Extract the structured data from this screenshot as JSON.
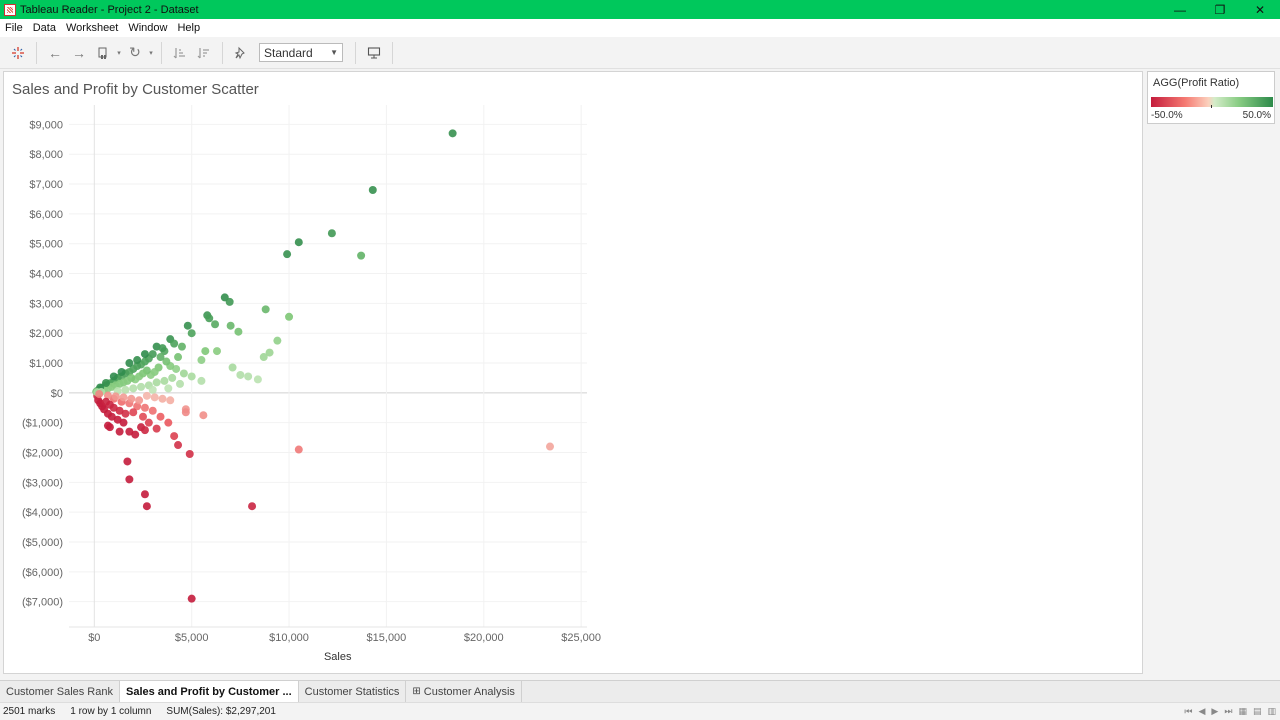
{
  "window": {
    "title": "Tableau Reader - Project 2 - Dataset",
    "minimize": "—",
    "maximize": "❐",
    "close": "✕"
  },
  "menu": [
    "File",
    "Data",
    "Worksheet",
    "Window",
    "Help"
  ],
  "toolbar": {
    "view_select": "Standard"
  },
  "sheet": {
    "title": "Sales and Profit by Customer Scatter"
  },
  "legend": {
    "title": "AGG(Profit Ratio)",
    "min_label": "-50.0%",
    "max_label": "50.0%"
  },
  "tabs": [
    "Customer Sales Rank",
    "Sales and Profit by Customer ...",
    "Customer Statistics",
    "Customer Analysis"
  ],
  "tabs_active": 1,
  "status": {
    "marks": "2501 marks",
    "layout": "1 row by 1 column",
    "sum": "SUM(Sales): $2,297,201"
  },
  "colors": {
    "titlebar": "#00c85c",
    "neg": "#c41c3c",
    "pos": "#2d8a4a"
  },
  "chart_data": {
    "type": "scatter",
    "title": "Sales and Profit by Customer Scatter",
    "xlabel": "Sales",
    "ylabel": "",
    "xlim": [
      -1300,
      25300
    ],
    "ylim": [
      -7850,
      9650
    ],
    "x_ticks": [
      0,
      5000,
      10000,
      15000,
      20000,
      25000
    ],
    "x_tick_labels": [
      "$0",
      "$5,000",
      "$10,000",
      "$15,000",
      "$20,000",
      "$25,000"
    ],
    "y_ticks": [
      9000,
      8000,
      7000,
      6000,
      5000,
      4000,
      3000,
      2000,
      1000,
      0,
      -1000,
      -2000,
      -3000,
      -4000,
      -5000,
      -6000,
      -7000
    ],
    "y_tick_labels": [
      "$9,000",
      "$8,000",
      "$7,000",
      "$6,000",
      "$5,000",
      "$4,000",
      "$3,000",
      "$2,000",
      "$1,000",
      "$0",
      "($1,000)",
      "($2,000)",
      "($3,000)",
      "($4,000)",
      "($5,000)",
      "($6,000)",
      "($7,000)"
    ],
    "color_by": "Profit Ratio",
    "color_range": [
      -0.5,
      0.5
    ],
    "points": [
      {
        "x": 18400,
        "y": 8700,
        "r": 0.47
      },
      {
        "x": 14300,
        "y": 6800,
        "r": 0.47
      },
      {
        "x": 12200,
        "y": 5350,
        "r": 0.44
      },
      {
        "x": 10500,
        "y": 5050,
        "r": 0.48
      },
      {
        "x": 9900,
        "y": 4650,
        "r": 0.47
      },
      {
        "x": 13700,
        "y": 4600,
        "r": 0.34
      },
      {
        "x": 6700,
        "y": 3200,
        "r": 0.48
      },
      {
        "x": 6950,
        "y": 3050,
        "r": 0.44
      },
      {
        "x": 8800,
        "y": 2800,
        "r": 0.32
      },
      {
        "x": 10000,
        "y": 2550,
        "r": 0.26
      },
      {
        "x": 5800,
        "y": 2600,
        "r": 0.45
      },
      {
        "x": 5900,
        "y": 2500,
        "r": 0.42
      },
      {
        "x": 6200,
        "y": 2300,
        "r": 0.37
      },
      {
        "x": 7000,
        "y": 2250,
        "r": 0.32
      },
      {
        "x": 4800,
        "y": 2250,
        "r": 0.47
      },
      {
        "x": 7400,
        "y": 2050,
        "r": 0.28
      },
      {
        "x": 5000,
        "y": 2000,
        "r": 0.4
      },
      {
        "x": 3900,
        "y": 1800,
        "r": 0.46
      },
      {
        "x": 9400,
        "y": 1750,
        "r": 0.19
      },
      {
        "x": 4500,
        "y": 1550,
        "r": 0.34
      },
      {
        "x": 5700,
        "y": 1400,
        "r": 0.25
      },
      {
        "x": 6300,
        "y": 1400,
        "r": 0.22
      },
      {
        "x": 9000,
        "y": 1350,
        "r": 0.15
      },
      {
        "x": 8700,
        "y": 1200,
        "r": 0.14
      },
      {
        "x": 3200,
        "y": 1550,
        "r": 0.48
      },
      {
        "x": 3600,
        "y": 1400,
        "r": 0.39
      },
      {
        "x": 4300,
        "y": 1200,
        "r": 0.28
      },
      {
        "x": 5500,
        "y": 1100,
        "r": 0.2
      },
      {
        "x": 7100,
        "y": 850,
        "r": 0.12
      },
      {
        "x": 7500,
        "y": 600,
        "r": 0.08
      },
      {
        "x": 7900,
        "y": 550,
        "r": 0.07
      },
      {
        "x": 8400,
        "y": 450,
        "r": 0.05
      },
      {
        "x": 5500,
        "y": 400,
        "r": 0.07
      },
      {
        "x": 5000,
        "y": 550,
        "r": 0.11
      },
      {
        "x": 4600,
        "y": 650,
        "r": 0.14
      },
      {
        "x": 4200,
        "y": 800,
        "r": 0.19
      },
      {
        "x": 3900,
        "y": 900,
        "r": 0.23
      },
      {
        "x": 3700,
        "y": 1050,
        "r": 0.28
      },
      {
        "x": 3400,
        "y": 1200,
        "r": 0.35
      },
      {
        "x": 3000,
        "y": 1300,
        "r": 0.43
      },
      {
        "x": 2800,
        "y": 1150,
        "r": 0.41
      },
      {
        "x": 2600,
        "y": 1050,
        "r": 0.4
      },
      {
        "x": 2400,
        "y": 950,
        "r": 0.39
      },
      {
        "x": 2200,
        "y": 900,
        "r": 0.41
      },
      {
        "x": 2000,
        "y": 800,
        "r": 0.4
      },
      {
        "x": 1800,
        "y": 700,
        "r": 0.39
      },
      {
        "x": 1600,
        "y": 650,
        "r": 0.41
      },
      {
        "x": 1400,
        "y": 550,
        "r": 0.39
      },
      {
        "x": 1200,
        "y": 500,
        "r": 0.42
      },
      {
        "x": 1000,
        "y": 400,
        "r": 0.4
      },
      {
        "x": 800,
        "y": 320,
        "r": 0.4
      },
      {
        "x": 600,
        "y": 250,
        "r": 0.42
      },
      {
        "x": 400,
        "y": 170,
        "r": 0.42
      },
      {
        "x": 200,
        "y": 90,
        "r": 0.45
      },
      {
        "x": 3300,
        "y": 850,
        "r": 0.26
      },
      {
        "x": 3100,
        "y": 700,
        "r": 0.23
      },
      {
        "x": 2900,
        "y": 600,
        "r": 0.21
      },
      {
        "x": 2700,
        "y": 750,
        "r": 0.28
      },
      {
        "x": 2500,
        "y": 650,
        "r": 0.26
      },
      {
        "x": 2300,
        "y": 550,
        "r": 0.24
      },
      {
        "x": 2100,
        "y": 450,
        "r": 0.21
      },
      {
        "x": 1900,
        "y": 500,
        "r": 0.26
      },
      {
        "x": 1700,
        "y": 400,
        "r": 0.24
      },
      {
        "x": 1500,
        "y": 350,
        "r": 0.23
      },
      {
        "x": 1300,
        "y": 300,
        "r": 0.23
      },
      {
        "x": 1100,
        "y": 250,
        "r": 0.23
      },
      {
        "x": 900,
        "y": 200,
        "r": 0.22
      },
      {
        "x": 700,
        "y": 150,
        "r": 0.21
      },
      {
        "x": 500,
        "y": 100,
        "r": 0.2
      },
      {
        "x": 4000,
        "y": 500,
        "r": 0.12
      },
      {
        "x": 3600,
        "y": 400,
        "r": 0.11
      },
      {
        "x": 3200,
        "y": 350,
        "r": 0.11
      },
      {
        "x": 2800,
        "y": 250,
        "r": 0.09
      },
      {
        "x": 2400,
        "y": 200,
        "r": 0.08
      },
      {
        "x": 2000,
        "y": 150,
        "r": 0.07
      },
      {
        "x": 1600,
        "y": 100,
        "r": 0.06
      },
      {
        "x": 1200,
        "y": 60,
        "r": 0.05
      },
      {
        "x": 4400,
        "y": 300,
        "r": 0.07
      },
      {
        "x": 3800,
        "y": 150,
        "r": 0.04
      },
      {
        "x": 3000,
        "y": 100,
        "r": 0.03
      },
      {
        "x": 1800,
        "y": 1000,
        "r": 0.49
      },
      {
        "x": 2200,
        "y": 1100,
        "r": 0.48
      },
      {
        "x": 2600,
        "y": 1300,
        "r": 0.49
      },
      {
        "x": 3500,
        "y": 1500,
        "r": 0.43
      },
      {
        "x": 4100,
        "y": 1650,
        "r": 0.4
      },
      {
        "x": 1400,
        "y": 700,
        "r": 0.49
      },
      {
        "x": 1000,
        "y": 550,
        "r": 0.49
      },
      {
        "x": 600,
        "y": 330,
        "r": 0.48
      },
      {
        "x": 300,
        "y": 180,
        "r": 0.49
      },
      {
        "x": 10500,
        "y": -1900,
        "r": -0.18
      },
      {
        "x": 23400,
        "y": -1800,
        "r": -0.08
      },
      {
        "x": 8100,
        "y": -3800,
        "r": -0.46
      },
      {
        "x": 5000,
        "y": -6900,
        "r": -0.5
      },
      {
        "x": 1700,
        "y": -2300,
        "r": -0.5
      },
      {
        "x": 1800,
        "y": -2900,
        "r": -0.5
      },
      {
        "x": 2600,
        "y": -3400,
        "r": -0.5
      },
      {
        "x": 2700,
        "y": -3800,
        "r": -0.5
      },
      {
        "x": 4900,
        "y": -2050,
        "r": -0.42
      },
      {
        "x": 4300,
        "y": -1750,
        "r": -0.41
      },
      {
        "x": 4100,
        "y": -1450,
        "r": -0.35
      },
      {
        "x": 3800,
        "y": -1000,
        "r": -0.26
      },
      {
        "x": 3400,
        "y": -800,
        "r": -0.24
      },
      {
        "x": 3000,
        "y": -600,
        "r": -0.2
      },
      {
        "x": 4700,
        "y": -550,
        "r": -0.12
      },
      {
        "x": 4700,
        "y": -650,
        "r": -0.14
      },
      {
        "x": 5600,
        "y": -750,
        "r": -0.13
      },
      {
        "x": 2600,
        "y": -500,
        "r": -0.19
      },
      {
        "x": 2200,
        "y": -450,
        "r": -0.2
      },
      {
        "x": 1800,
        "y": -350,
        "r": -0.19
      },
      {
        "x": 1400,
        "y": -300,
        "r": -0.21
      },
      {
        "x": 1000,
        "y": -200,
        "r": -0.2
      },
      {
        "x": 3900,
        "y": -250,
        "r": -0.06
      },
      {
        "x": 3500,
        "y": -200,
        "r": -0.06
      },
      {
        "x": 3100,
        "y": -150,
        "r": -0.05
      },
      {
        "x": 2700,
        "y": -100,
        "r": -0.04
      },
      {
        "x": 2300,
        "y": -250,
        "r": -0.11
      },
      {
        "x": 1900,
        "y": -200,
        "r": -0.11
      },
      {
        "x": 1500,
        "y": -150,
        "r": -0.1
      },
      {
        "x": 1100,
        "y": -120,
        "r": -0.11
      },
      {
        "x": 700,
        "y": -90,
        "r": -0.13
      },
      {
        "x": 2800,
        "y": -1000,
        "r": -0.36
      },
      {
        "x": 2400,
        "y": -1150,
        "r": -0.48
      },
      {
        "x": 2100,
        "y": -1400,
        "r": -0.5
      },
      {
        "x": 1800,
        "y": -1300,
        "r": -0.5
      },
      {
        "x": 1300,
        "y": -1300,
        "r": -0.5
      },
      {
        "x": 800,
        "y": -1150,
        "r": -0.5
      },
      {
        "x": 700,
        "y": -1100,
        "r": -0.5
      },
      {
        "x": 1500,
        "y": -1000,
        "r": -0.5
      },
      {
        "x": 1200,
        "y": -900,
        "r": -0.5
      },
      {
        "x": 900,
        "y": -800,
        "r": -0.5
      },
      {
        "x": 700,
        "y": -700,
        "r": -0.5
      },
      {
        "x": 500,
        "y": -550,
        "r": -0.5
      },
      {
        "x": 400,
        "y": -450,
        "r": -0.5
      },
      {
        "x": 300,
        "y": -350,
        "r": -0.5
      },
      {
        "x": 200,
        "y": -250,
        "r": -0.5
      },
      {
        "x": 1600,
        "y": -700,
        "r": -0.42
      },
      {
        "x": 1300,
        "y": -600,
        "r": -0.44
      },
      {
        "x": 1000,
        "y": -500,
        "r": -0.45
      },
      {
        "x": 800,
        "y": -400,
        "r": -0.46
      },
      {
        "x": 600,
        "y": -300,
        "r": -0.47
      },
      {
        "x": 2000,
        "y": -650,
        "r": -0.33
      },
      {
        "x": 2500,
        "y": -800,
        "r": -0.32
      },
      {
        "x": 3200,
        "y": -1200,
        "r": -0.38
      },
      {
        "x": 2600,
        "y": -1250,
        "r": -0.45
      },
      {
        "x": 150,
        "y": -100,
        "r": -0.45
      },
      {
        "x": 100,
        "y": 40,
        "r": 0.3
      },
      {
        "x": 150,
        "y": 20,
        "r": 0.1
      },
      {
        "x": 350,
        "y": 30,
        "r": 0.08
      },
      {
        "x": 250,
        "y": -40,
        "r": -0.15
      }
    ]
  }
}
